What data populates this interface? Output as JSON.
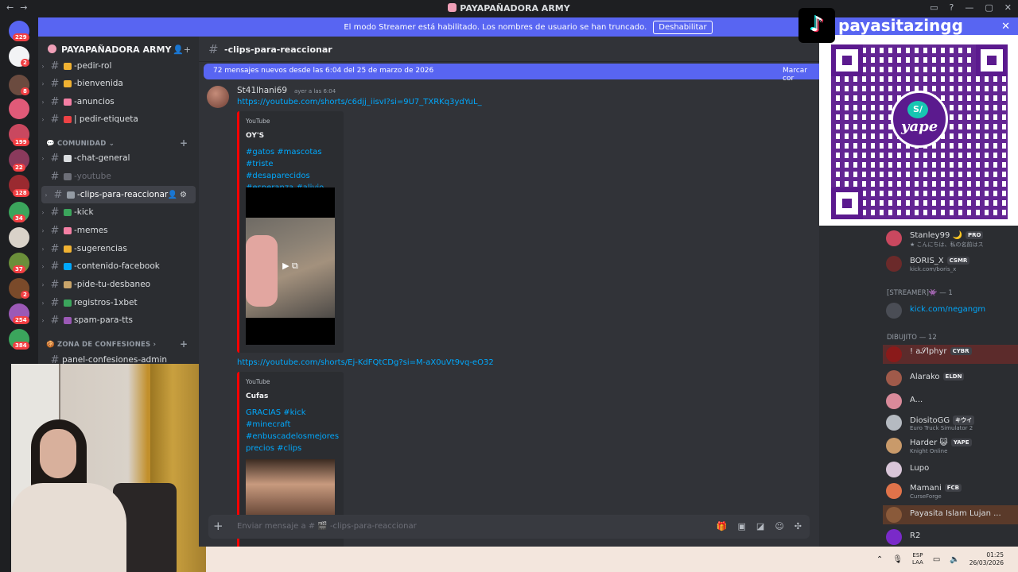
{
  "window": {
    "title": "PAYAPAÑADORA ARMY"
  },
  "banner": {
    "text": "El modo Streamer está habilitado. Los nombres de usuario se han truncado.",
    "button": "Deshabilitar"
  },
  "rail": {
    "badges": [
      "229",
      "2",
      "8",
      "199",
      "22",
      "128",
      "34",
      "37",
      "2",
      "254",
      "384"
    ]
  },
  "sidebar": {
    "server_name": "PAYAPAÑADORA ARMY",
    "channels_top": [
      {
        "name": "-pedir-rol",
        "color": "#f0b232"
      },
      {
        "name": "-bienvenida",
        "color": "#f0b232"
      },
      {
        "name": "-anuncios",
        "color": "#f47fa4"
      },
      {
        "name": "| pedir-etiqueta",
        "color": "#ed4245"
      }
    ],
    "category_comunidad": "COMUNIDAD",
    "channels_comunidad": [
      {
        "name": "-chat-general",
        "color": "#dbdee1",
        "muted": false
      },
      {
        "name": "-youtube",
        "color": "#949ba4",
        "muted": true
      },
      {
        "name": "-clips-para-reaccionar",
        "color": "#949ba4",
        "muted": false,
        "active": true
      },
      {
        "name": "-kick",
        "color": "#3ba55c",
        "muted": false
      },
      {
        "name": "-memes",
        "color": "#f47fa4",
        "muted": false
      },
      {
        "name": "-sugerencias",
        "color": "#f0b232",
        "muted": false
      },
      {
        "name": "-contenido-facebook",
        "color": "#5865f2",
        "muted": false
      },
      {
        "name": "-pide-tu-desbaneo",
        "color": "#c9a56a",
        "muted": false
      },
      {
        "name": "registros-1xbet",
        "color": "#3ba55c",
        "muted": false
      },
      {
        "name": "spam-para-tts",
        "color": "#9b59b6",
        "muted": false
      }
    ],
    "category_confesiones": "ZONA DE CONFESIONES",
    "channels_confesiones": [
      {
        "name": "panel-confesiones-admin"
      }
    ]
  },
  "chat": {
    "channel_name": "-clips-para-reaccionar",
    "new_messages": "72 mensajes nuevos desde las 6:04 del 25 de marzo de 2026",
    "mark_read": "Marcar cor",
    "author": "St41lhani69",
    "time": "ayer a las 6:04",
    "link1": "https://youtube.com/shorts/c6djj_iisvI?si=9U7_TXRKq3ydYuL_",
    "embed1": {
      "provider": "YouTube",
      "title": "OY'S",
      "desc": "#gatos #mascotas #triste #desaparecidos #esperanza #alivio"
    },
    "link2": "https://youtube.com/shorts/Ej-KdFQtCDg?si=M-aX0uVt9vq-eO32",
    "embed2": {
      "provider": "YouTube",
      "title": "Cufas",
      "desc": "GRACIAS #kick #minecraft #enbuscadelosmejores precios #clips"
    },
    "composer_placeholder": "Enviar mensaje a # 🎬 -clips-para-reaccionar"
  },
  "overlay": {
    "tiktok_handle": "payasitazingg",
    "yape_label": "yape",
    "yape_symbol": "S/"
  },
  "members": {
    "rows": [
      {
        "name": "Stanley99 🌙",
        "tag": "PRO",
        "status": "★ こんにちは、私の名前はス"
      },
      {
        "name": "BORIS_X",
        "tag": "CSMR",
        "status": "kick.com/boris_x"
      }
    ],
    "cat_streamer": "[STREAMER]👾 — 1",
    "streamer": {
      "name": "kick.com/negangm"
    },
    "cat_dibujito": "DIBUJITO — 12",
    "dibujito": [
      {
        "name": "! a𝒮lphyr",
        "tag": "CYBR",
        "status": ""
      },
      {
        "name": "Alarako",
        "tag": "ELDN",
        "status": ""
      },
      {
        "name": "A...",
        "tag": "",
        "status": ""
      },
      {
        "name": "DiositoGG",
        "tag": "キウイ",
        "status": "Euro Truck Simulator 2"
      },
      {
        "name": "Harder 😺",
        "tag": "YAPE",
        "status": "Knight Online"
      },
      {
        "name": "Lupo",
        "tag": "",
        "status": ""
      },
      {
        "name": "Mamani",
        "tag": "FCB",
        "status": "CurseForge"
      },
      {
        "name": "Payasita Islam Lujan ...",
        "tag": "",
        "status": ""
      },
      {
        "name": "R2",
        "tag": "",
        "status": ""
      }
    ]
  },
  "taskbar": {
    "lang_top": "ESP",
    "lang_bottom": "LAA",
    "time": "01:25",
    "date": "26/03/2026"
  }
}
